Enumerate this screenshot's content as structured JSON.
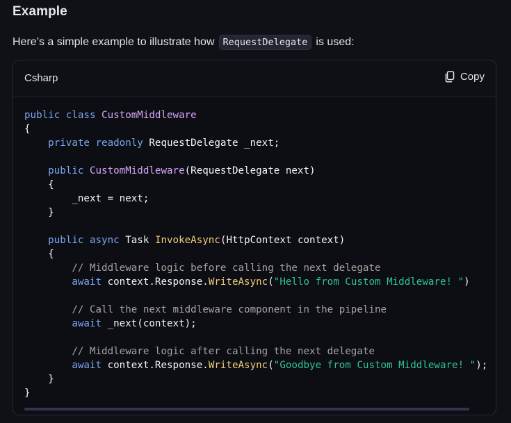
{
  "heading": "Example",
  "intro": {
    "before": "Here’s a simple example to illustrate how",
    "code": "RequestDelegate",
    "after": "is used:"
  },
  "code_block": {
    "language": "Csharp",
    "copy_label": "Copy",
    "icons": {
      "copy": "copy-icon"
    },
    "lines": [
      [
        {
          "t": "public class ",
          "c": "kw"
        },
        {
          "t": "CustomMiddleware",
          "c": "type"
        }
      ],
      [
        {
          "t": "{",
          "c": "plain"
        }
      ],
      [
        {
          "t": "    private readonly ",
          "c": "kw"
        },
        {
          "t": "RequestDelegate _next;",
          "c": "plain"
        }
      ],
      [],
      [
        {
          "t": "    public ",
          "c": "kw"
        },
        {
          "t": "CustomMiddleware",
          "c": "type"
        },
        {
          "t": "(RequestDelegate next)",
          "c": "plain"
        }
      ],
      [
        {
          "t": "    {",
          "c": "plain"
        }
      ],
      [
        {
          "t": "        _next = next;",
          "c": "plain"
        }
      ],
      [
        {
          "t": "    }",
          "c": "plain"
        }
      ],
      [],
      [
        {
          "t": "    public async ",
          "c": "kw"
        },
        {
          "t": "Task ",
          "c": "plain"
        },
        {
          "t": "InvokeAsync",
          "c": "fn"
        },
        {
          "t": "(HttpContext context)",
          "c": "plain"
        }
      ],
      [
        {
          "t": "    {",
          "c": "plain"
        }
      ],
      [
        {
          "t": "        // Middleware logic before calling the next delegate",
          "c": "cm"
        }
      ],
      [
        {
          "t": "        await ",
          "c": "kw"
        },
        {
          "t": "context.Response.",
          "c": "plain"
        },
        {
          "t": "WriteAsync",
          "c": "fn"
        },
        {
          "t": "(",
          "c": "plain"
        },
        {
          "t": "\"Hello from Custom Middleware! \"",
          "c": "str"
        },
        {
          "t": ")",
          "c": "plain"
        }
      ],
      [],
      [
        {
          "t": "        // Call the next middleware component in the pipeline",
          "c": "cm"
        }
      ],
      [
        {
          "t": "        await ",
          "c": "kw"
        },
        {
          "t": "_next(context);",
          "c": "plain"
        }
      ],
      [],
      [
        {
          "t": "        // Middleware logic after calling the next delegate",
          "c": "cm"
        }
      ],
      [
        {
          "t": "        await ",
          "c": "kw"
        },
        {
          "t": "context.Response.",
          "c": "plain"
        },
        {
          "t": "WriteAsync",
          "c": "fn"
        },
        {
          "t": "(",
          "c": "plain"
        },
        {
          "t": "\"Goodbye from Custom Middleware! \"",
          "c": "str"
        },
        {
          "t": ");",
          "c": "plain"
        }
      ],
      [
        {
          "t": "    }",
          "c": "plain"
        }
      ],
      [
        {
          "t": "}",
          "c": "plain"
        }
      ]
    ]
  }
}
